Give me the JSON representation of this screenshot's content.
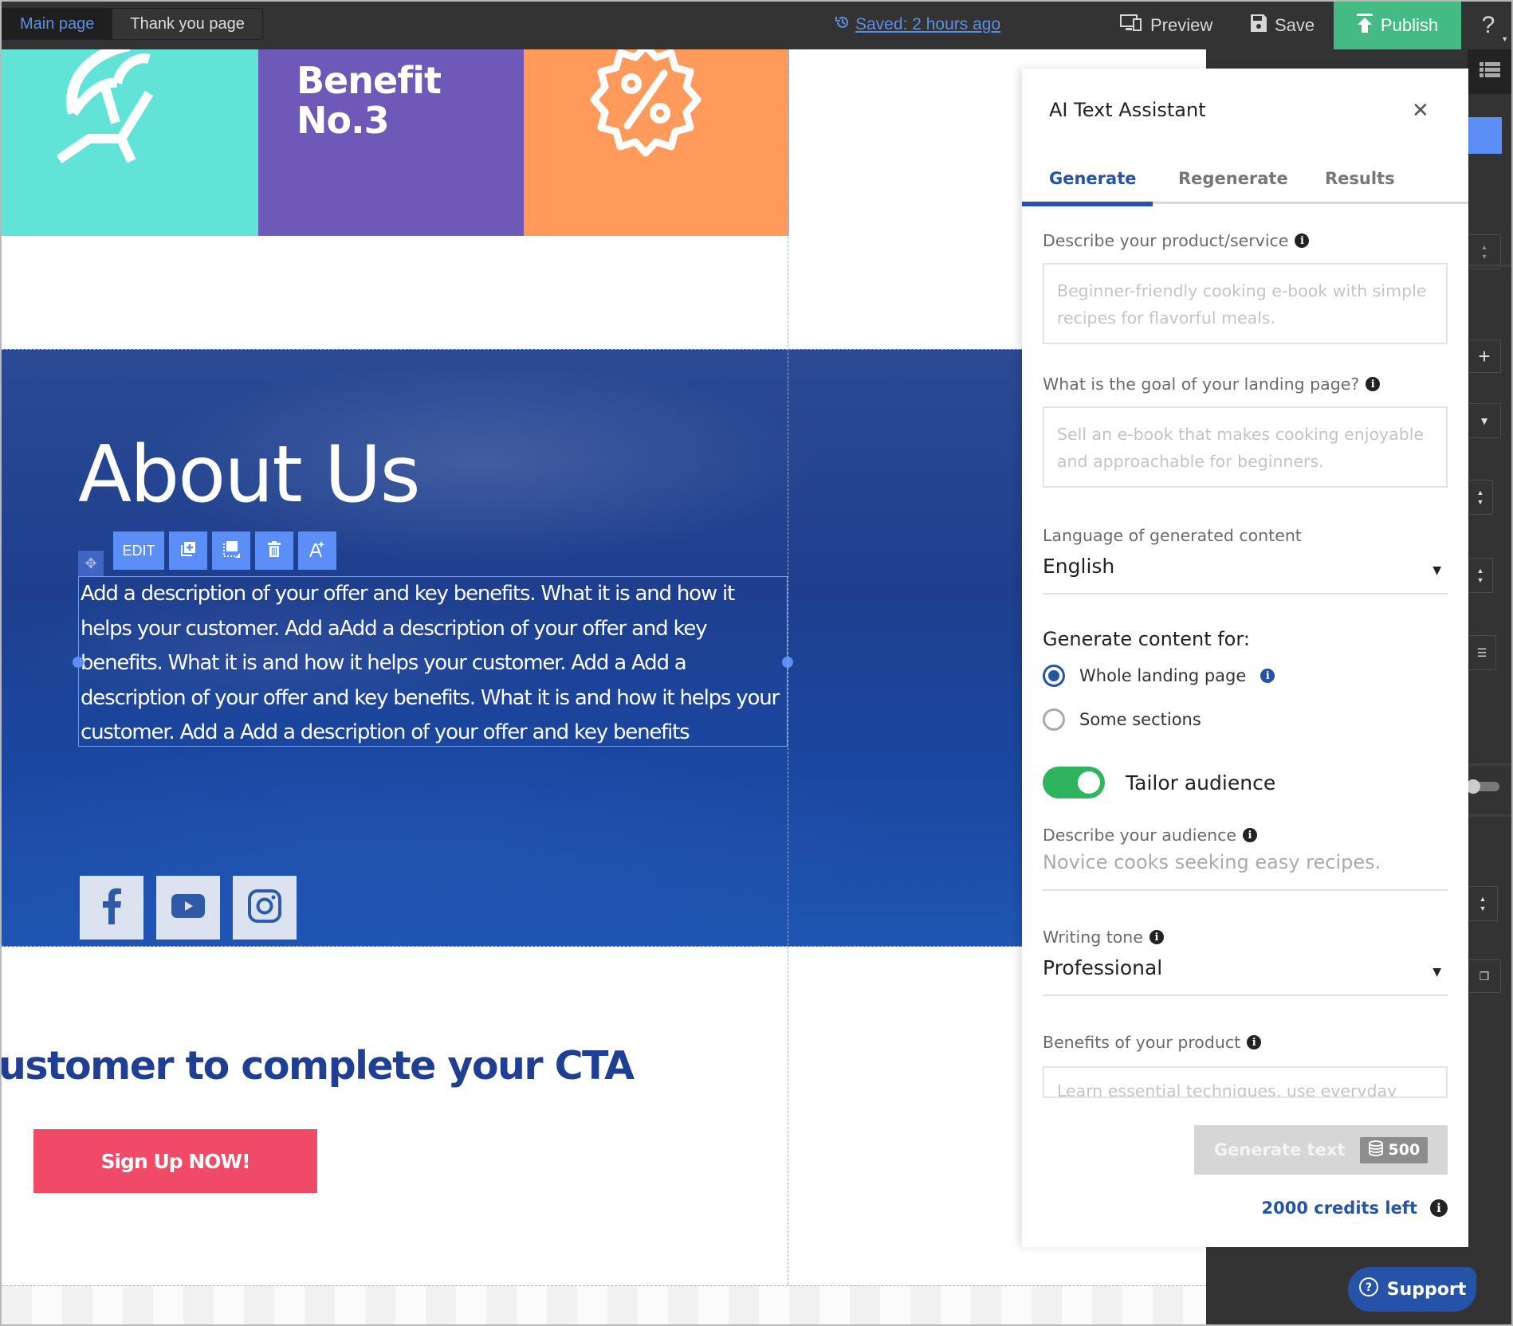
{
  "topbar": {
    "page_tabs": [
      {
        "label": "Main page",
        "active": true
      },
      {
        "label": "Thank you page",
        "active": false
      }
    ],
    "saved_status": "Saved: 2 hours ago",
    "preview_label": "Preview",
    "save_label": "Save",
    "publish_label": "Publish",
    "help_label": "?"
  },
  "canvas": {
    "tiles": [
      {
        "color": "#61e3d7",
        "icon": "beach-chair-icon"
      },
      {
        "color": "#6e58b8",
        "title": "Benefit No.3",
        "title_line1": "Benefit",
        "title_line2": "No.3"
      },
      {
        "color": "#ff9a5b",
        "icon": "discount-badge-icon"
      }
    ],
    "about": {
      "title": "About Us",
      "edit_toolbar": {
        "edit_label": "EDIT",
        "buttons": [
          "duplicate-icon",
          "background-icon",
          "delete-icon",
          "ai-text-icon"
        ]
      },
      "body": "Add a description of your offer and key benefits. What it is and how it helps your customer. Add aAdd a description of your offer and key benefits. What it is and how it helps your customer. Add a Add a description of your offer and key benefits. What it is and how it helps your customer. Add a Add a description of your offer and key benefits",
      "socials": [
        "facebook",
        "youtube",
        "instagram"
      ]
    },
    "cta": {
      "heading": "ustomer to complete your CTA",
      "button_label": "Sign Up NOW!",
      "button_color": "#f14a66"
    }
  },
  "ai_panel": {
    "title": "AI Text Assistant",
    "tabs": [
      {
        "label": "Generate",
        "active": true
      },
      {
        "label": "Regenerate",
        "active": false
      },
      {
        "label": "Results",
        "active": false
      }
    ],
    "product_label": "Describe your product/service",
    "product_placeholder": "Beginner-friendly cooking e-book with simple recipes for flavorful meals.",
    "goal_label": "What is the goal of your landing page?",
    "goal_placeholder": "Sell an e-book that makes cooking enjoyable and approachable for beginners.",
    "language_label": "Language of generated content",
    "language_value": "English",
    "generate_for_label": "Generate content for:",
    "generate_for_options": [
      {
        "label": "Whole landing page",
        "selected": true
      },
      {
        "label": "Some sections",
        "selected": false
      }
    ],
    "tailor_label": "Tailor audience",
    "tailor_on": true,
    "audience_label": "Describe your audience",
    "audience_placeholder": "Novice cooks seeking easy recipes.",
    "tone_label": "Writing tone",
    "tone_value": "Professional",
    "benefits_label": "Benefits of your product",
    "benefits_placeholder": "Learn essential techniques, use everyday",
    "generate_button": "Generate text",
    "generate_cost": "500",
    "credits_left": "2000 credits left"
  },
  "support_label": "Support",
  "colors": {
    "accent": "#2553a8",
    "publish": "#45bb84",
    "toggle_on": "#2eb35e",
    "link": "#5b8fe6"
  }
}
